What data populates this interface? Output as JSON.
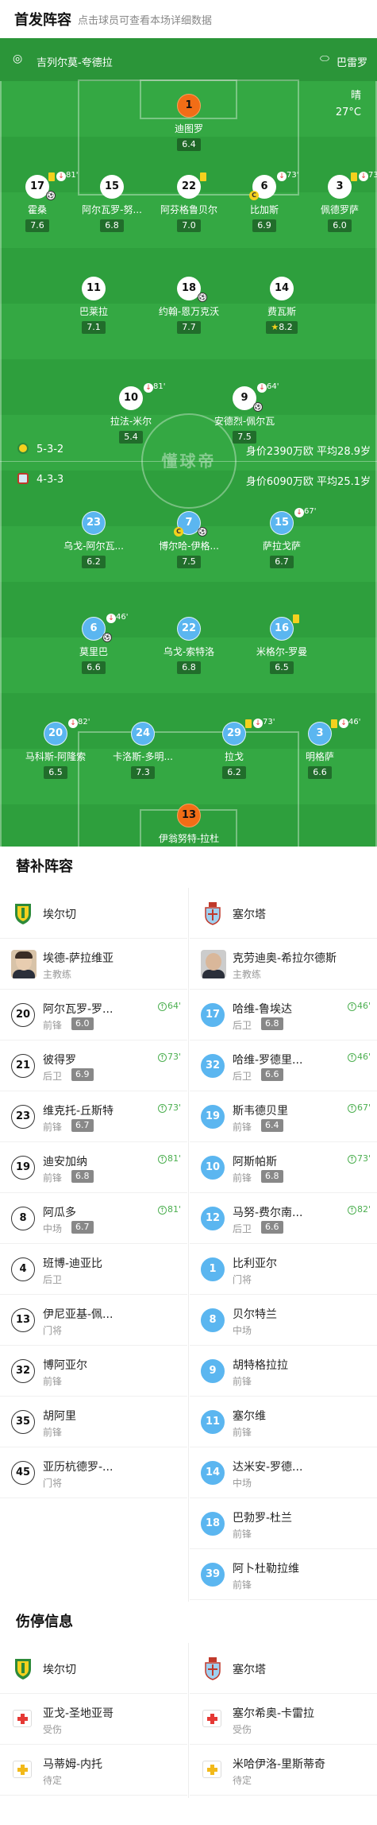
{
  "header": {
    "title": "首发阵容",
    "subtitle": "点击球员可查看本场详细数据"
  },
  "pitch": {
    "home_team": "吉列尔莫-夸德拉",
    "away_team": "巴雷罗",
    "weather": "晴",
    "temp": "27°C",
    "watermark": "懂球帝",
    "home_formation": "5-3-2",
    "home_info": "身价2390万欧 平均28.9岁",
    "away_formation": "4-3-3",
    "away_info": "身价6090万欧 平均25.1岁",
    "players": [
      {
        "num": "1",
        "name": "迪图罗",
        "rating": "6.4",
        "style": "o"
      },
      {
        "num": "17",
        "name": "霍桑",
        "rating": "7.6",
        "style": "w",
        "min": "81'",
        "card": true,
        "sub": true,
        "ball": true
      },
      {
        "num": "15",
        "name": "阿尔瓦罗-努...",
        "rating": "6.8",
        "style": "w"
      },
      {
        "num": "22",
        "name": "阿芬格鲁贝尔",
        "rating": "7.0",
        "style": "w",
        "card": true
      },
      {
        "num": "6",
        "name": "比加斯",
        "rating": "6.9",
        "style": "w",
        "min": "73'",
        "sub": true,
        "cap": true
      },
      {
        "num": "3",
        "name": "佩德罗萨",
        "rating": "6.0",
        "style": "w",
        "min": "73'",
        "card": true,
        "sub": true
      },
      {
        "num": "11",
        "name": "巴莱拉",
        "rating": "7.1",
        "style": "w"
      },
      {
        "num": "18",
        "name": "约翰-恩万克沃",
        "rating": "7.7",
        "style": "w",
        "ball": true
      },
      {
        "num": "14",
        "name": "费瓦斯",
        "rating": "8.2",
        "style": "w",
        "star": true
      },
      {
        "num": "10",
        "name": "拉法-米尔",
        "rating": "5.4",
        "style": "w",
        "min": "81'",
        "sub": true
      },
      {
        "num": "9",
        "name": "安德烈-佩尔瓦",
        "rating": "7.5",
        "style": "w",
        "min": "64'",
        "sub": true,
        "ball": true
      },
      {
        "num": "23",
        "name": "乌戈-阿尔瓦...",
        "rating": "6.2",
        "style": "b"
      },
      {
        "num": "7",
        "name": "博尔哈-伊格...",
        "rating": "7.5",
        "style": "b",
        "cap": true,
        "ball": true
      },
      {
        "num": "15",
        "name": "萨拉戈萨",
        "rating": "6.7",
        "style": "b",
        "min": "67'",
        "sub": true
      },
      {
        "num": "6",
        "name": "莫里巴",
        "rating": "6.6",
        "style": "b",
        "min": "46'",
        "sub": true,
        "ball": true
      },
      {
        "num": "22",
        "name": "乌戈-索特洛",
        "rating": "6.8",
        "style": "b"
      },
      {
        "num": "16",
        "name": "米格尔-罗曼",
        "rating": "6.5",
        "style": "b",
        "card": true
      },
      {
        "num": "20",
        "name": "马科斯-阿隆索",
        "rating": "6.5",
        "style": "b",
        "min": "82'",
        "sub": true
      },
      {
        "num": "24",
        "name": "卡洛斯-多明...",
        "rating": "7.3",
        "style": "b"
      },
      {
        "num": "29",
        "name": "拉戈",
        "rating": "6.2",
        "style": "b",
        "min": "73'",
        "card": true,
        "sub": true
      },
      {
        "num": "3",
        "name": "明格萨",
        "rating": "6.6",
        "style": "b",
        "min": "46'",
        "card": true,
        "sub": true
      },
      {
        "num": "13",
        "name": "伊翁努特-拉杜",
        "rating": "7.8",
        "style": "o"
      }
    ]
  },
  "subs": {
    "title": "替补阵容",
    "home": {
      "team": "埃尔切",
      "coach_name": "埃德-萨拉维亚",
      "coach_role": "主教练",
      "players": [
        {
          "num": "20",
          "name": "阿尔瓦罗-罗...",
          "pos": "前锋",
          "rating": "6.0",
          "min": "64'"
        },
        {
          "num": "21",
          "name": "彼得罗",
          "pos": "后卫",
          "rating": "6.9",
          "min": "73'"
        },
        {
          "num": "23",
          "name": "维克托-丘斯特",
          "pos": "前锋",
          "rating": "6.7",
          "min": "73'"
        },
        {
          "num": "19",
          "name": "迪安加纳",
          "pos": "前锋",
          "rating": "6.8",
          "min": "81'"
        },
        {
          "num": "8",
          "name": "阿瓜多",
          "pos": "中场",
          "rating": "6.7",
          "min": "81'"
        },
        {
          "num": "4",
          "name": "班博-迪亚比",
          "pos": "后卫"
        },
        {
          "num": "13",
          "name": "伊尼亚基-佩...",
          "pos": "门将"
        },
        {
          "num": "32",
          "name": "博阿亚尔",
          "pos": "前锋"
        },
        {
          "num": "35",
          "name": "胡阿里",
          "pos": "前锋"
        },
        {
          "num": "45",
          "name": "亚历杭德罗-...",
          "pos": "门将"
        }
      ]
    },
    "away": {
      "team": "塞尔塔",
      "coach_name": "克劳迪奥-希拉尔德斯",
      "coach_role": "主教练",
      "players": [
        {
          "num": "17",
          "name": "哈维-鲁埃达",
          "pos": "后卫",
          "rating": "6.8",
          "min": "46'"
        },
        {
          "num": "32",
          "name": "哈维-罗德里...",
          "pos": "后卫",
          "rating": "6.6",
          "min": "46'"
        },
        {
          "num": "19",
          "name": "斯韦德贝里",
          "pos": "前锋",
          "rating": "6.4",
          "min": "67'"
        },
        {
          "num": "10",
          "name": "阿斯帕斯",
          "pos": "前锋",
          "rating": "6.8",
          "min": "73'"
        },
        {
          "num": "12",
          "name": "马努-费尔南...",
          "pos": "后卫",
          "rating": "6.6",
          "min": "82'"
        },
        {
          "num": "1",
          "name": "比利亚尔",
          "pos": "门将"
        },
        {
          "num": "8",
          "name": "贝尔特兰",
          "pos": "中场"
        },
        {
          "num": "9",
          "name": "胡特格拉拉",
          "pos": "前锋"
        },
        {
          "num": "11",
          "name": "塞尔维",
          "pos": "前锋"
        },
        {
          "num": "14",
          "name": "达米安-罗德...",
          "pos": "中场"
        },
        {
          "num": "18",
          "name": "巴勃罗-杜兰",
          "pos": "前锋"
        },
        {
          "num": "39",
          "name": "阿卜杜勒拉维",
          "pos": "前锋"
        }
      ]
    }
  },
  "injuries": {
    "title": "伤停信息",
    "home": {
      "team": "埃尔切",
      "players": [
        {
          "name": "亚戈-圣地亚哥",
          "status": "受伤",
          "type": "injury"
        },
        {
          "name": "马蒂姆-内托",
          "status": "待定",
          "type": "doubt"
        }
      ]
    },
    "away": {
      "team": "塞尔塔",
      "players": [
        {
          "name": "塞尔希奥-卡雷拉",
          "status": "受伤",
          "type": "injury"
        },
        {
          "name": "米哈伊洛-里斯蒂奇",
          "status": "待定",
          "type": "doubt"
        }
      ]
    }
  }
}
